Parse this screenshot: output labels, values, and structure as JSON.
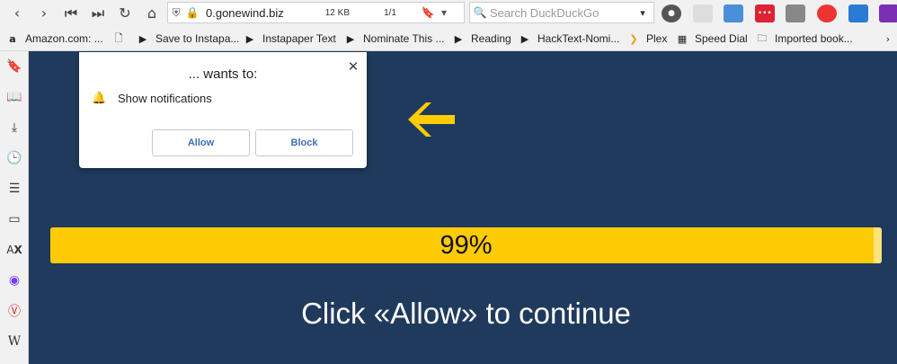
{
  "toolbar": {
    "url": "0.gonewind.biz",
    "size": "12 KB",
    "pages": "1/1",
    "search_placeholder": "Search DuckDuckGo"
  },
  "bookmarks": [
    {
      "label": "Amazon.com: ...",
      "icon": "amazon-icon"
    },
    {
      "label": "",
      "icon": "page-icon"
    },
    {
      "label": "Save to Instapa...",
      "icon": "bookmarklet-icon"
    },
    {
      "label": "Instapaper Text",
      "icon": "bookmarklet-icon"
    },
    {
      "label": "Nominate This ...",
      "icon": "bookmarklet-icon"
    },
    {
      "label": "Reading",
      "icon": "bookmarklet-icon"
    },
    {
      "label": "HackText-Nomi...",
      "icon": "bookmarklet-icon"
    },
    {
      "label": "Plex",
      "icon": "plex-icon"
    },
    {
      "label": "Speed Dial",
      "icon": "speed-dial-icon"
    },
    {
      "label": "Imported book...",
      "icon": "folder-icon"
    }
  ],
  "popup": {
    "title": "... wants to:",
    "permission": "Show notifications",
    "allow": "Allow",
    "block": "Block"
  },
  "progress": {
    "label": "99%",
    "value": 0.99
  },
  "cta": "Click «Allow» to continue",
  "colors": {
    "background": "#1f3a5c",
    "accent": "#ffcb05",
    "button_text": "#3b6fb5"
  }
}
